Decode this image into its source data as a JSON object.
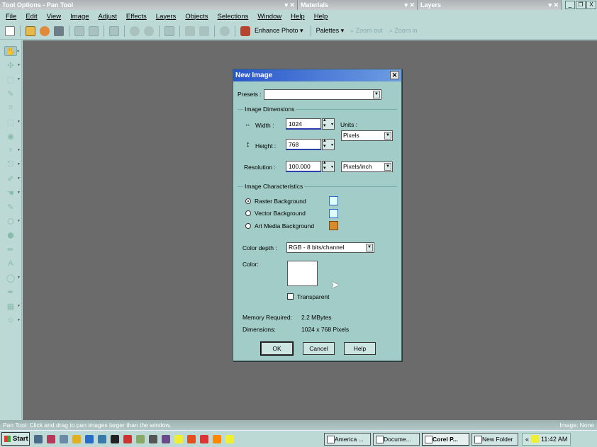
{
  "palettes": {
    "tool_options": {
      "title": "Tool Options - Pan Tool",
      "controls": "▾ ✕"
    },
    "materials": {
      "title": "Materials",
      "controls": "▾ ✕"
    },
    "layers": {
      "title": "Layers",
      "controls": "▾ ✕"
    }
  },
  "window_buttons": {
    "minimize": "_",
    "restore": "❐",
    "close": "X"
  },
  "menu": [
    "File",
    "Edit",
    "View",
    "Image",
    "Adjust",
    "Effects",
    "Layers",
    "Objects",
    "Selections",
    "Window",
    "Help",
    "Help"
  ],
  "toolbar": {
    "enhance_photo": "Enhance Photo ▾",
    "palettes": "Palettes ▾",
    "zoom_out": "Zoom out",
    "zoom_in": "Zoom in"
  },
  "dialog": {
    "title": "New Image",
    "close": "✕",
    "presets_label": "Presets :",
    "presets_value": "",
    "dims_group": "Image Dimensions",
    "width_label": "Width :",
    "width_value": "1024",
    "height_label": "Height :",
    "height_value": "768",
    "units_label": "Units :",
    "units_value": "Pixels",
    "resolution_label": "Resolution :",
    "resolution_value": "100.000",
    "resolution_units": "Pixels/inch",
    "char_group": "Image Characteristics",
    "bg_options": [
      "Raster Background",
      "Vector Background",
      "Art Media Background"
    ],
    "selected_bg": "Raster Background",
    "color_depth_label": "Color depth :",
    "color_depth_value": "RGB - 8 bits/channel",
    "color_label": "Color:",
    "color_value": "#ffffff",
    "transparent_label": "Transparent",
    "transparent_checked": false,
    "memory_label": "Memory Required:",
    "memory_value": "2.2 MBytes",
    "dimensions_label": "Dimensions:",
    "dimensions_value": "1024 x 768 Pixels",
    "ok": "OK",
    "cancel": "Cancel",
    "help": "Help"
  },
  "status": {
    "left": "Pan Tool: Click and drag to pan images larger than the window.",
    "right": "Image: None"
  },
  "taskbar": {
    "start": "Start",
    "tasks": [
      "America ...",
      "Docume...",
      "Corel P...",
      "New Folder"
    ],
    "active_task": "Corel P...",
    "tray_prefix": "«",
    "clock": "11:42 AM"
  },
  "colors": {
    "accent": "#2a57c9",
    "dialog_bg": "#a2ccc7",
    "chrome": "#bdd9d6",
    "workspace": "#6b6b6b"
  },
  "icons": [
    "new-icon",
    "open-icon",
    "browse-icon",
    "scan-icon",
    "save-icon",
    "print-icon",
    "email-icon",
    "undo-icon",
    "redo-icon",
    "crop-icon",
    "flip-icon",
    "info-icon",
    "enhance-photo-icon",
    "zoom-out-icon",
    "zoom-in-icon"
  ]
}
